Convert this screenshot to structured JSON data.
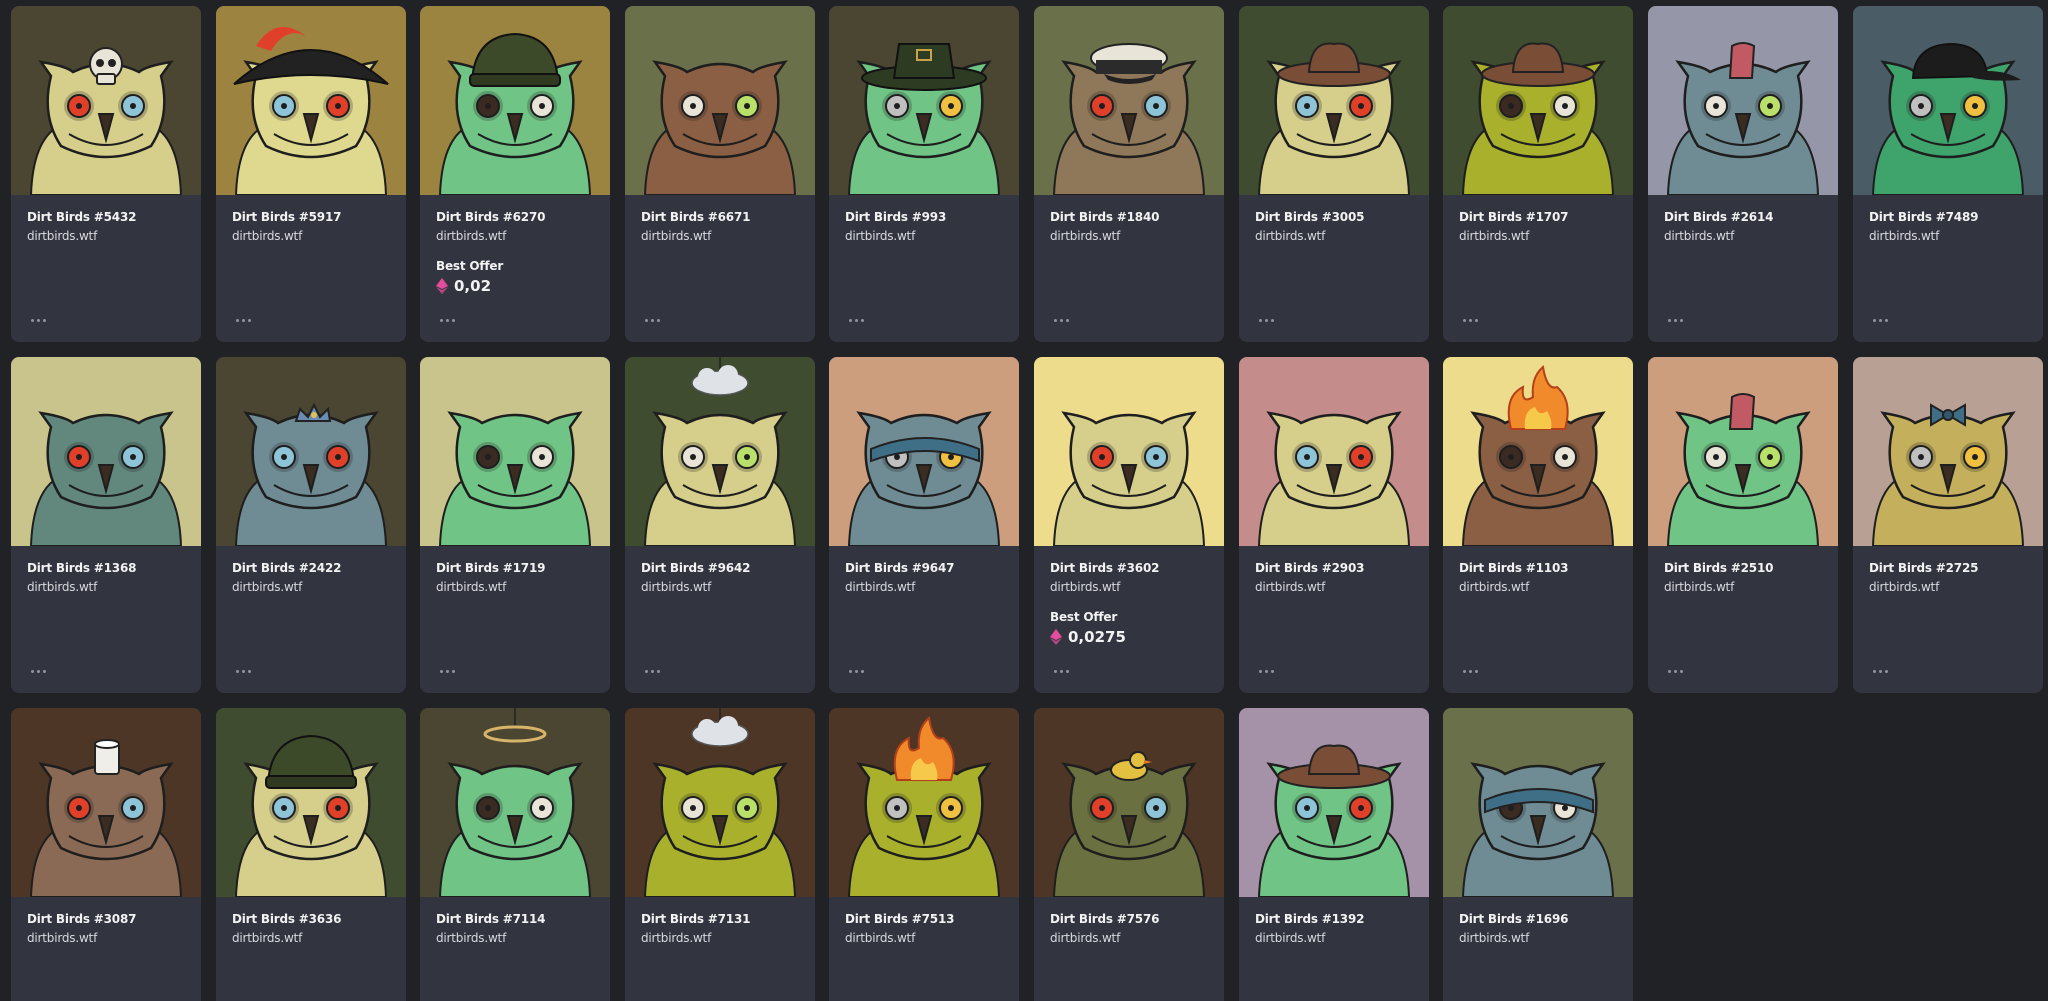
{
  "collection_name": "dirtbirds.wtf",
  "offer_label": "Best Offer",
  "more_icon": "ellipsis-icon",
  "currency_icon": "eth-icon",
  "currency_color": "#e44d9b",
  "cards": [
    {
      "title": "Dirt Birds #5432",
      "bg": "#4a4632",
      "body": "#d6cf8c",
      "accessory": "skull",
      "offer": null
    },
    {
      "title": "Dirt Birds #5917",
      "bg": "#9c8440",
      "body": "#dfd990",
      "accessory": "pirate-hat",
      "offer": null
    },
    {
      "title": "Dirt Birds #6270",
      "bg": "#9a8440",
      "body": "#6fc486",
      "accessory": "beanie",
      "offer": "0,02"
    },
    {
      "title": "Dirt Birds #6671",
      "bg": "#6a7049",
      "body": "#8a5f44",
      "accessory": "none",
      "offer": null
    },
    {
      "title": "Dirt Birds #993",
      "bg": "#4a4632",
      "body": "#6fc486",
      "accessory": "green-hat",
      "offer": null
    },
    {
      "title": "Dirt Birds #1840",
      "bg": "#6a7049",
      "body": "#8f7759",
      "accessory": "captain-hat",
      "offer": null
    },
    {
      "title": "Dirt Birds #3005",
      "bg": "#3f4c2f",
      "body": "#d6cf8c",
      "accessory": "cowboy-hat",
      "offer": null
    },
    {
      "title": "Dirt Birds #1707",
      "bg": "#3f4c2f",
      "body": "#a8b02c",
      "accessory": "cowboy-hat",
      "offer": null
    },
    {
      "title": "Dirt Birds #2614",
      "bg": "#9597a9",
      "body": "#6f8c94",
      "accessory": "mohawk",
      "offer": null
    },
    {
      "title": "Dirt Birds #7489",
      "bg": "#4a5d66",
      "body": "#3fa36c",
      "accessory": "cap",
      "offer": null
    },
    {
      "title": "Dirt Birds #1368",
      "bg": "#c8c48c",
      "body": "#62887e",
      "accessory": "none",
      "offer": null
    },
    {
      "title": "Dirt Birds #2422",
      "bg": "#4a4632",
      "body": "#6f8c94",
      "accessory": "crown",
      "offer": null
    },
    {
      "title": "Dirt Birds #1719",
      "bg": "#c8c48c",
      "body": "#6fc486",
      "accessory": "none",
      "offer": null
    },
    {
      "title": "Dirt Birds #9642",
      "bg": "#3f4c2f",
      "body": "#d6cf8c",
      "accessory": "cloud",
      "offer": null
    },
    {
      "title": "Dirt Birds #9647",
      "bg": "#cc9e7e",
      "body": "#6f8c94",
      "accessory": "headband",
      "offer": null
    },
    {
      "title": "Dirt Birds #3602",
      "bg": "#ecdc8c",
      "body": "#d6cf8c",
      "accessory": "none",
      "offer": "0,0275"
    },
    {
      "title": "Dirt Birds #2903",
      "bg": "#c58c8c",
      "body": "#d6cf8c",
      "accessory": "none",
      "offer": null
    },
    {
      "title": "Dirt Birds #1103",
      "bg": "#ecdc8c",
      "body": "#8a5f44",
      "accessory": "fire",
      "offer": null
    },
    {
      "title": "Dirt Birds #2510",
      "bg": "#cc9e7e",
      "body": "#6fc486",
      "accessory": "mohawk",
      "offer": null
    },
    {
      "title": "Dirt Birds #2725",
      "bg": "#b8a094",
      "body": "#c4b05c",
      "accessory": "bow",
      "offer": null
    },
    {
      "title": "Dirt Birds #3087",
      "bg": "#4e3626",
      "body": "#8a6a54",
      "accessory": "toilet-paper",
      "offer": null
    },
    {
      "title": "Dirt Birds #3636",
      "bg": "#3f4c2f",
      "body": "#d6cf8c",
      "accessory": "beanie",
      "offer": null
    },
    {
      "title": "Dirt Birds #7114",
      "bg": "#4a4632",
      "body": "#6fc486",
      "accessory": "halo",
      "offer": null
    },
    {
      "title": "Dirt Birds #7131",
      "bg": "#4e3626",
      "body": "#a8b02c",
      "accessory": "cloud",
      "offer": null
    },
    {
      "title": "Dirt Birds #7513",
      "bg": "#4e3626",
      "body": "#a8b02c",
      "accessory": "fire",
      "offer": null
    },
    {
      "title": "Dirt Birds #7576",
      "bg": "#4e3626",
      "body": "#6a7040",
      "accessory": "duck",
      "offer": null
    },
    {
      "title": "Dirt Birds #1392",
      "bg": "#a592a8",
      "body": "#6fc486",
      "accessory": "cowboy-hat",
      "offer": null
    },
    {
      "title": "Dirt Birds #1696",
      "bg": "#6a7049",
      "body": "#6f8c94",
      "accessory": "headband",
      "offer": null
    }
  ]
}
